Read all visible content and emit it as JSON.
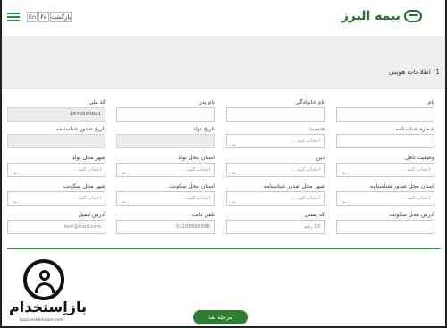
{
  "header": {
    "logo_text": "بیمه البرز",
    "lang_en": "En",
    "lang_fa": "Fa",
    "back_label": "بازگشت"
  },
  "section": {
    "title": "1) اطلاعات هویتی"
  },
  "fields": {
    "first_name": {
      "label": "نام",
      "value": ""
    },
    "last_name": {
      "label": "نام خانوادگی",
      "value": ""
    },
    "father_name": {
      "label": "نام پدر",
      "value": ""
    },
    "national_code": {
      "label": "کد ملی",
      "value": "1870694821"
    },
    "id_number": {
      "label": "شماره شناسنامه",
      "value": ""
    },
    "gender": {
      "label": "جنسیت",
      "placeholder": "انتخاب کنید ..."
    },
    "birth_date": {
      "label": "تاریخ تولد",
      "value": ""
    },
    "id_issue_date": {
      "label": "تاریخ صدور شناسنامه",
      "value": ""
    },
    "marital_status": {
      "label": "وضعیت تاهل",
      "placeholder": "انتخاب کنید ..."
    },
    "religion": {
      "label": "دین",
      "placeholder": "انتخاب کنید ..."
    },
    "birth_province": {
      "label": "استان محل تولد",
      "placeholder": "انتخاب کنید ..."
    },
    "birth_city": {
      "label": "شهر محل تولد",
      "placeholder": "انتخاب کنید ..."
    },
    "issue_province": {
      "label": "استان محل صدور شناسنامه",
      "placeholder": "انتخاب کنید ..."
    },
    "issue_city": {
      "label": "شهر محل صدور شناسنامه",
      "placeholder": "انتخاب کنید ..."
    },
    "residence_province": {
      "label": "استان محل سکونت",
      "placeholder": "انتخاب کنید ..."
    },
    "residence_city": {
      "label": "شهر محل سکونت",
      "placeholder": "انتخاب کنید ..."
    },
    "address": {
      "label": "آدرس محل سکونت",
      "value": ""
    },
    "postal_code": {
      "label": "کد پستی",
      "placeholder": "10 رقم"
    },
    "phone": {
      "label": "تلفن ثابت",
      "placeholder": "02188888888"
    },
    "email": {
      "label": "آدرس ایمیل",
      "placeholder": "test@mail.com"
    }
  },
  "next_label": "مرحله بعد",
  "watermark": {
    "text": "بازاِستخدام",
    "url": "bazarestekhdam.com"
  },
  "colors": {
    "brand_green": "#2e7d32",
    "banner_gray": "#efefef"
  }
}
